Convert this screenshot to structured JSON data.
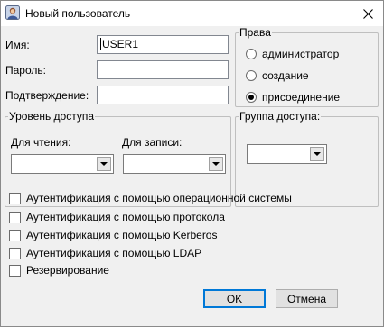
{
  "window": {
    "title": "Новый пользователь",
    "icons": {
      "app": "user-icon",
      "close": "close-icon"
    }
  },
  "fields": {
    "name_label": "Имя:",
    "name_value": "USER1",
    "password_label": "Пароль:",
    "password_value": "",
    "confirm_label": "Подтверждение:",
    "confirm_value": ""
  },
  "rights": {
    "title": "Права",
    "options": [
      {
        "label": "администратор",
        "selected": false
      },
      {
        "label": "создание",
        "selected": false
      },
      {
        "label": "присоединение",
        "selected": true
      }
    ]
  },
  "access_level": {
    "title": "Уровень доступа",
    "read_label": "Для чтения:",
    "read_value": "",
    "write_label": "Для записи:",
    "write_value": ""
  },
  "access_group": {
    "title": "Группа доступа:",
    "value": ""
  },
  "checkboxes": [
    {
      "label": "Аутентификация с помощью операционной системы",
      "checked": false
    },
    {
      "label": "Аутентификация с помощью протокола",
      "checked": false
    },
    {
      "label": "Аутентификация с помощью Kerberos",
      "checked": false
    },
    {
      "label": "Аутентификация с помощью LDAP",
      "checked": false
    },
    {
      "label": "Резервирование",
      "checked": false
    }
  ],
  "buttons": {
    "ok": "OK",
    "cancel": "Отмена"
  }
}
